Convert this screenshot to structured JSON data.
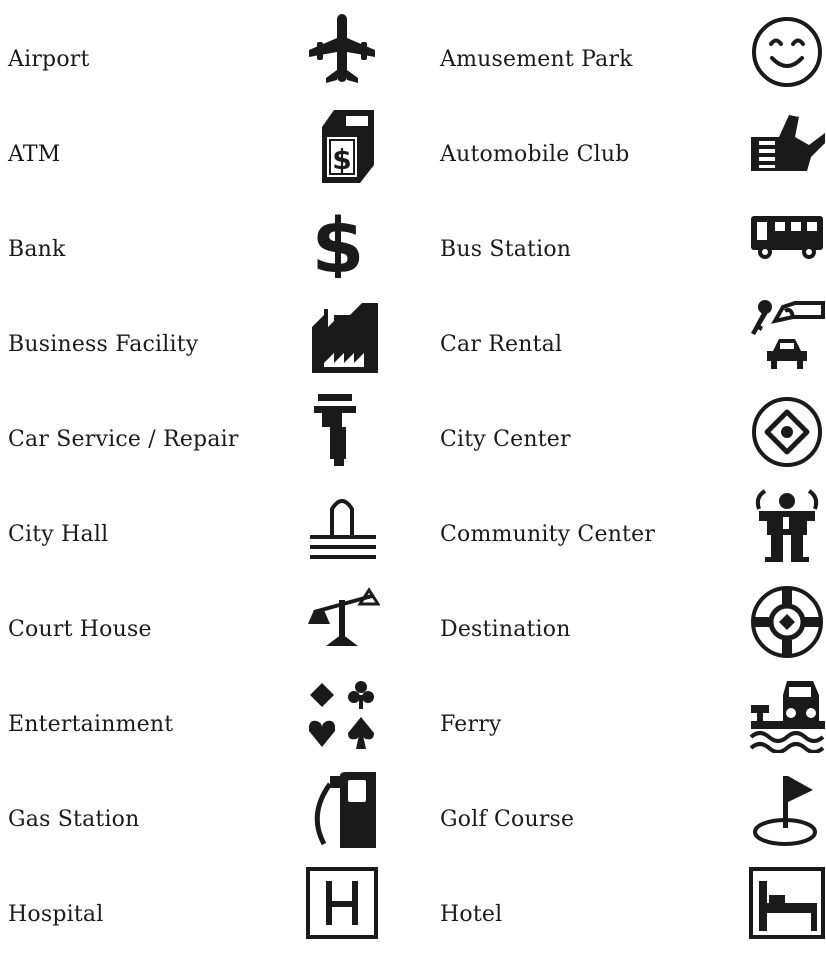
{
  "legend": {
    "rows": [
      {
        "left": {
          "label": "Airport",
          "icon": "airplane-icon"
        },
        "right": {
          "label": "Amusement Park",
          "icon": "smiley-face-icon"
        }
      },
      {
        "left": {
          "label": "ATM",
          "icon": "atm-machine-icon"
        },
        "right": {
          "label": "Automobile Club",
          "icon": "hand-card-icon"
        }
      },
      {
        "left": {
          "label": "Bank",
          "icon": "dollar-sign-icon"
        },
        "right": {
          "label": "Bus Station",
          "icon": "bus-icon"
        }
      },
      {
        "left": {
          "label": "Business Facility",
          "icon": "factory-icon"
        },
        "right": {
          "label": "Car Rental",
          "icon": "key-car-icon"
        }
      },
      {
        "left": {
          "label": "Car Service / Repair",
          "icon": "wrench-clamp-icon"
        },
        "right": {
          "label": "City Center",
          "icon": "target-circle-icon"
        }
      },
      {
        "left": {
          "label": "City Hall",
          "icon": "city-hall-icon"
        },
        "right": {
          "label": "Community Center",
          "icon": "person-icon"
        }
      },
      {
        "left": {
          "label": "Court House",
          "icon": "scales-icon"
        },
        "right": {
          "label": "Destination",
          "icon": "crosshair-icon"
        }
      },
      {
        "left": {
          "label": "Entertainment",
          "icon": "card-suits-icon"
        },
        "right": {
          "label": "Ferry",
          "icon": "ferry-icon"
        }
      },
      {
        "left": {
          "label": "Gas Station",
          "icon": "fuel-pump-icon"
        },
        "right": {
          "label": "Golf Course",
          "icon": "golf-flag-icon"
        }
      },
      {
        "left": {
          "label": "Hospital",
          "icon": "hospital-h-icon"
        },
        "right": {
          "label": "Hotel",
          "icon": "bed-icon"
        }
      }
    ],
    "colors": {
      "ink": "#1a1a1a",
      "background": "#ffffff"
    }
  }
}
